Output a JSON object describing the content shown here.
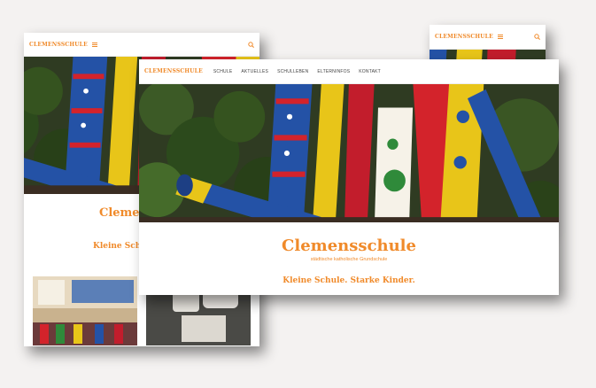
{
  "site": {
    "brand": "CLEMENSSCHULE",
    "title": "Clemensschule",
    "subtitle": "städtische katholische Grundschule",
    "tagline": "Kleine Schule. Starke Kinder."
  },
  "nav": {
    "items": [
      "SCHULE",
      "AKTUELLES",
      "SCHULLEBEN",
      "ELTERNINFOS",
      "KONTAKT"
    ]
  },
  "icons": {
    "menu": "hamburger-menu-icon",
    "search": "search-icon"
  },
  "colors": {
    "accent": "#f08a2a",
    "background": "#f4f2f1"
  },
  "mobile_left": {
    "title_visible": "Clemens",
    "tagline_visible": "Kleine Schule"
  }
}
